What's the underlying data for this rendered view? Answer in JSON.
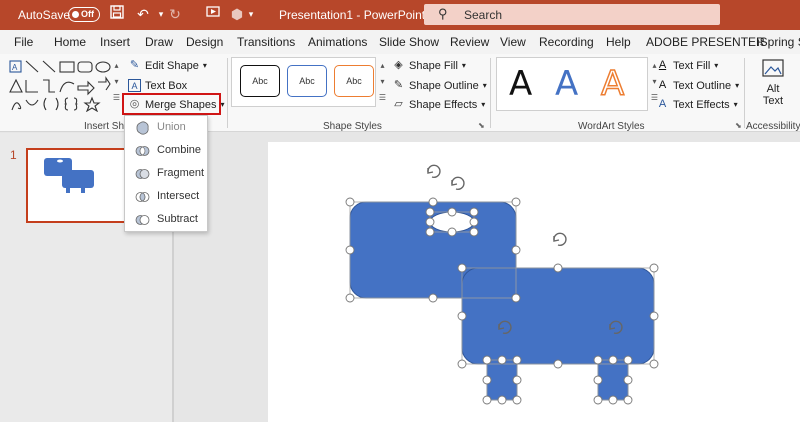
{
  "titlebar": {
    "autosave_label": "AutoSave",
    "toggle_state": "Off",
    "title": "Presentation1  -  PowerPoint",
    "search_placeholder": "Search",
    "bg_color": "#b7472a"
  },
  "tabs": [
    "File",
    "Home",
    "Insert",
    "Draw",
    "Design",
    "Transitions",
    "Animations",
    "Slide Show",
    "Review",
    "View",
    "Recording",
    "Help",
    "ADOBE PRESENTER",
    "iSpring S"
  ],
  "ribbon": {
    "edit_shape": "Edit Shape",
    "text_box": "Text Box",
    "merge_shapes": "Merge Shapes",
    "insert_shapes_group": "Insert Sha",
    "shape_style_sample": "Abc",
    "shape_fill": "Shape Fill",
    "shape_outline": "Shape Outline",
    "shape_effects": "Shape Effects",
    "shape_styles_group": "Shape Styles",
    "wordart_letter": "A",
    "text_fill": "Text Fill",
    "text_outline": "Text Outline",
    "text_effects": "Text Effects",
    "wordart_group": "WordArt Styles",
    "alt_text_line1": "Alt",
    "alt_text_line2": "Text",
    "accessibility_group": "Accessibility"
  },
  "merge_menu": {
    "items": [
      "Union",
      "Combine",
      "Fragment",
      "Intersect",
      "Subtract"
    ]
  },
  "slides_pane": {
    "slide_number": "1"
  },
  "colors": {
    "shape_blue": "#4472c4",
    "shape_border": "#2f5597",
    "accent_red": "#d01515"
  }
}
